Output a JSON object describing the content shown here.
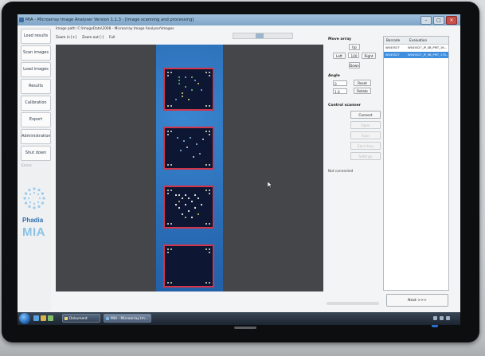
{
  "window": {
    "title": "MIA - Microarray Image Analyser Version 1.1.3 - [Image scanning and processing]"
  },
  "nav": {
    "items": [
      {
        "label": "Load results"
      },
      {
        "label": "Scan images"
      },
      {
        "label": "Load images"
      },
      {
        "label": "Results"
      },
      {
        "label": "Calibration"
      },
      {
        "label": "Export"
      },
      {
        "label": "Administration"
      },
      {
        "label": "Shut down"
      }
    ],
    "secondary_label": "Errors",
    "logo_brand": "Phadia",
    "logo_product": "MIA"
  },
  "viewer": {
    "image_path": "Image path: C:\\ImageData\\2008 - Microarray Image Analyser\\Images",
    "zoom_in": "Zoom in [+]",
    "zoom_out": "Zoom out [-]",
    "zoom_full": "Full",
    "well_count": 4
  },
  "move_array": {
    "label": "Move array",
    "up": "Up",
    "left": "Left",
    "step_value": "100",
    "right": "Right",
    "down": "Down"
  },
  "angle": {
    "label": "Angle",
    "value": "0",
    "reset": "Reset",
    "step_value": "1.0",
    "rotate": "Rotate"
  },
  "scanner": {
    "label": "Control scanner",
    "connect": "Connect",
    "btn2": "Open",
    "btn3": "Scan",
    "btn4": "Eject tray",
    "btn5": "Settings",
    "status": "Not connected"
  },
  "barcode_table": {
    "columns": [
      "Barcode",
      "Evaluation"
    ],
    "rows": [
      {
        "barcode": "W045527",
        "evaluation": "W045527_JP_SB_PMT_16...",
        "selected": false
      },
      {
        "barcode": "W045527",
        "evaluation": "W045527_JP_SB_PMT_170...",
        "selected": true
      }
    ]
  },
  "next_button": "Next >>>",
  "taskbar": {
    "items": [
      {
        "label": "Dokument",
        "active": false
      },
      {
        "label": "MIA - Microarray Im...",
        "active": true
      }
    ]
  }
}
